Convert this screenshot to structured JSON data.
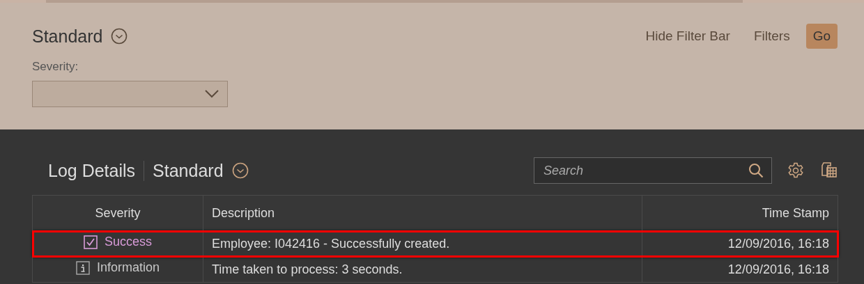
{
  "filter_bar": {
    "variant": "Standard",
    "actions": [
      {
        "label": "Hide Filter Bar",
        "kind": "link"
      },
      {
        "label": "Filters",
        "kind": "link"
      },
      {
        "label": "Go",
        "kind": "emphasized"
      }
    ],
    "fields": [
      {
        "label": "Severity:"
      }
    ]
  },
  "table": {
    "title": "Log Details",
    "variant": "Standard",
    "search": {
      "placeholder": "Search"
    },
    "columns": [
      {
        "label": "Severity"
      },
      {
        "label": "Description"
      },
      {
        "label": "Time Stamp"
      }
    ],
    "rows": [
      {
        "severity": "Success",
        "kind": "success",
        "description": "Employee: I042416 - Successfully created.",
        "time": "12/09/2016, 16:18",
        "highlighted": true
      },
      {
        "severity": "Information",
        "kind": "information",
        "description": "Time taken to process: 3 seconds.",
        "time": "12/09/2016, 16:18",
        "highlighted": false
      }
    ]
  }
}
